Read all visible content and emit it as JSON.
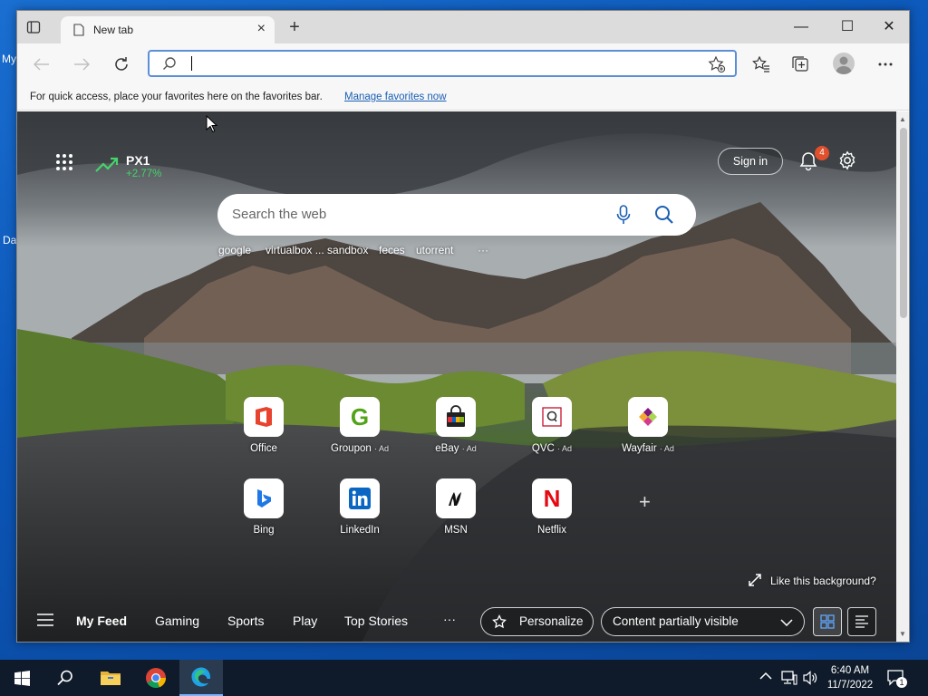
{
  "desktop": {
    "icon_label_1": "My",
    "icon_label_2": "Da"
  },
  "browser": {
    "tab": {
      "title": "New tab",
      "close": "×"
    },
    "new_tab": "+",
    "window_controls": {
      "minimize": "—",
      "maximize": "☐",
      "close": "✕"
    },
    "address_bar": {
      "value": "",
      "placeholder": ""
    },
    "favorites_bar": {
      "message": "For quick access, place your favorites here on the favorites bar.",
      "link": "Manage favorites now"
    },
    "colors": {
      "accent": "#5b8fd6",
      "link": "#1a5fb4"
    }
  },
  "newtab": {
    "stock": {
      "symbol": "PX1",
      "change": "+2.77%",
      "color": "#46d36b"
    },
    "sign_in": "Sign in",
    "notifications_count": "4",
    "search": {
      "placeholder": "Search the web"
    },
    "trending": [
      "google",
      "virtualbox ... sandbox",
      "feces",
      "utorrent",
      "···"
    ],
    "quick_links": [
      {
        "name": "Office",
        "ad": "",
        "icon": "office-icon"
      },
      {
        "name": "Groupon",
        "ad": "Ad",
        "icon": "groupon-icon"
      },
      {
        "name": "eBay",
        "ad": "Ad",
        "icon": "ebay-icon"
      },
      {
        "name": "QVC",
        "ad": "Ad",
        "icon": "qvc-icon"
      },
      {
        "name": "Wayfair",
        "ad": "Ad",
        "icon": "wayfair-icon"
      },
      {
        "name": "Bing",
        "ad": "",
        "icon": "bing-icon"
      },
      {
        "name": "LinkedIn",
        "ad": "",
        "icon": "linkedin-icon"
      },
      {
        "name": "MSN",
        "ad": "",
        "icon": "msn-icon"
      },
      {
        "name": "Netflix",
        "ad": "",
        "icon": "netflix-icon"
      }
    ],
    "add_site": "+",
    "like_background": "Like this background?",
    "feed_tabs": [
      "My Feed",
      "Gaming",
      "Sports",
      "Play",
      "Top Stories"
    ],
    "feed_more": "···",
    "personalize": "Personalize",
    "content_visibility": "Content partially visible"
  },
  "taskbar": {
    "time": "6:40 AM",
    "date": "11/7/2022",
    "notification_count": "1"
  }
}
